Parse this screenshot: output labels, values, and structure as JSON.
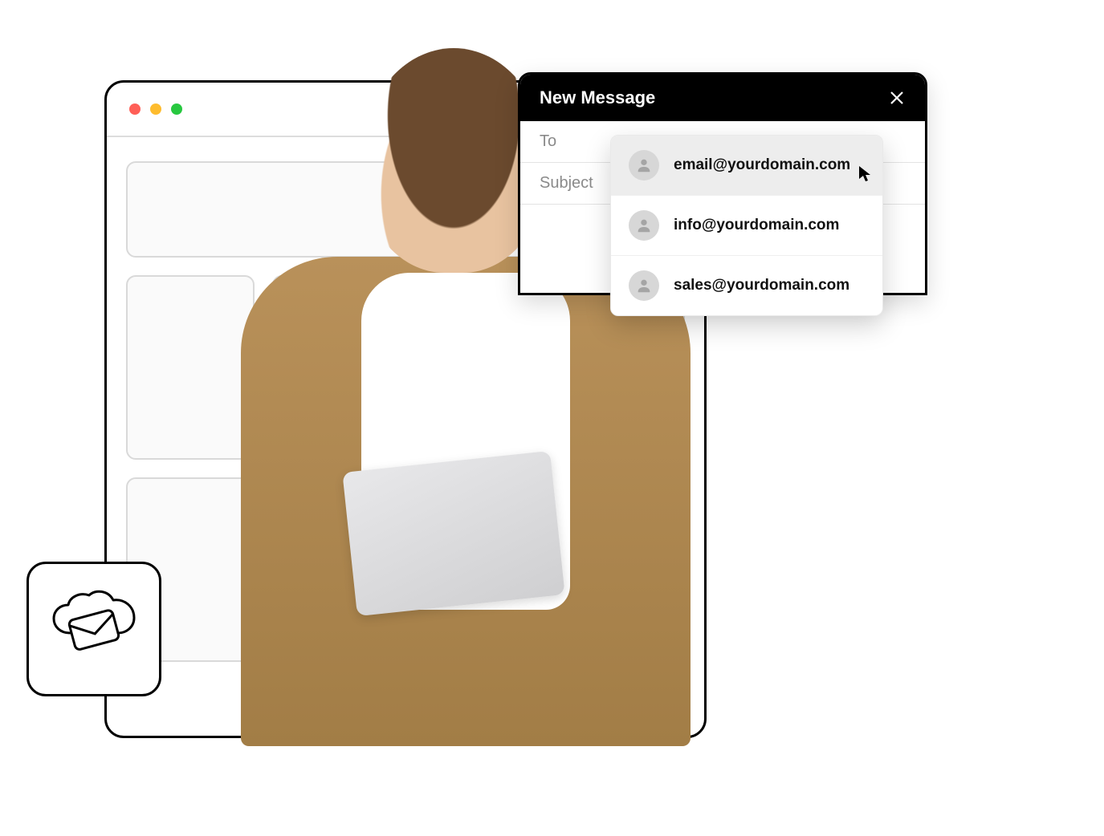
{
  "compose": {
    "title": "New Message",
    "to_label": "To",
    "subject_label": "Subject"
  },
  "suggestions": [
    {
      "email": "email@yourdomain.com",
      "highlighted": true
    },
    {
      "email": "info@yourdomain.com",
      "highlighted": false
    },
    {
      "email": "sales@yourdomain.com",
      "highlighted": false
    }
  ],
  "icons": {
    "close": "close-icon",
    "cloud_mail": "cloud-mail-icon",
    "person": "person-avatar-icon",
    "cursor": "cursor-icon"
  }
}
